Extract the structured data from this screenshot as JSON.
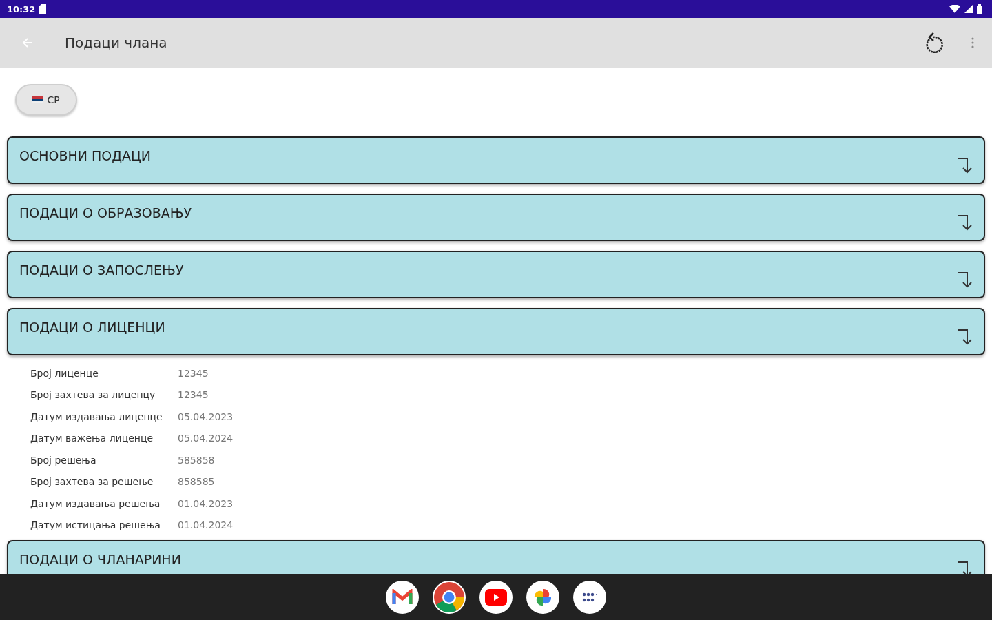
{
  "status_bar": {
    "time": "10:32"
  },
  "app_bar": {
    "title": "Подаци члана"
  },
  "language_chip": {
    "label": "СР"
  },
  "sections": [
    {
      "title": "ОСНОВНИ ПОДАЦИ"
    },
    {
      "title": "ПОДАЦИ О ОБРАЗОВАЊУ"
    },
    {
      "title": "ПОДАЦИ О ЗАПОСЛЕЊУ"
    },
    {
      "title": "ПОДАЦИ О ЛИЦЕНЦИ",
      "fields": [
        {
          "label": "Број лиценце",
          "value": "12345"
        },
        {
          "label": "Број захтева за лиценцу",
          "value": "12345"
        },
        {
          "label": "Датум издавања лиценце",
          "value": "05.04.2023"
        },
        {
          "label": "Датум важења лиценце",
          "value": "05.04.2024"
        },
        {
          "label": "Број решења",
          "value": "585858"
        },
        {
          "label": "Број захтева за решење",
          "value": "858585"
        },
        {
          "label": "Датум издавања решења",
          "value": "01.04.2023"
        },
        {
          "label": "Датум истицања решења",
          "value": "01.04.2024"
        }
      ]
    },
    {
      "title": "ПОДАЦИ О ЧЛАНАРИНИ"
    }
  ],
  "dock": [
    {
      "kind": "mail"
    },
    {
      "kind": "browser"
    },
    {
      "kind": "video"
    },
    {
      "kind": "photos"
    },
    {
      "kind": "apps"
    }
  ]
}
